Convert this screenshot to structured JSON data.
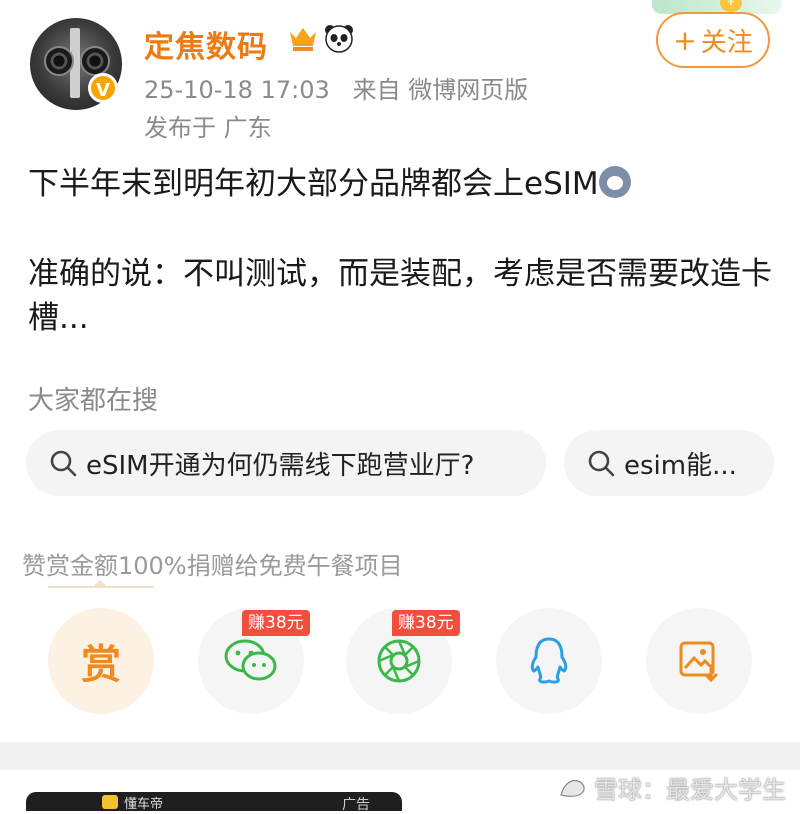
{
  "author": {
    "name": "定焦数码",
    "verified_badge": "V",
    "badges": [
      "crown-badge",
      "panda-badge"
    ]
  },
  "post_meta": {
    "timestamp": "25-10-18 17:03",
    "source": "来自 微博网页版",
    "location": "发布于 广东"
  },
  "follow_button": {
    "label": "关注",
    "icon": "+"
  },
  "post": {
    "line1": "下半年末到明年初大部分品牌都会上eSIM",
    "line2": "准确的说：不叫测试，而是装配，考虑是否需要改造卡槽..."
  },
  "search": {
    "section_label": "大家都在搜",
    "chips": [
      "eSIM开通为何仍需线下跑营业厅?",
      "esim能..."
    ]
  },
  "reward": {
    "label": "赞赏金额100%捐赠给免费午餐项目",
    "reward_button": "赏",
    "share_tags": [
      "赚38元",
      "赚38元"
    ],
    "share_icons": [
      "wechat-icon",
      "moments-icon",
      "qq-icon",
      "save-image-icon"
    ]
  },
  "ad": {
    "brand": "懂车帝",
    "label": "广告"
  },
  "watermark": "雪球：最爱大学生",
  "colors": {
    "accent": "#f08a1a",
    "tag_red": "#f24e3e",
    "chip_bg": "#f4f4f4"
  }
}
